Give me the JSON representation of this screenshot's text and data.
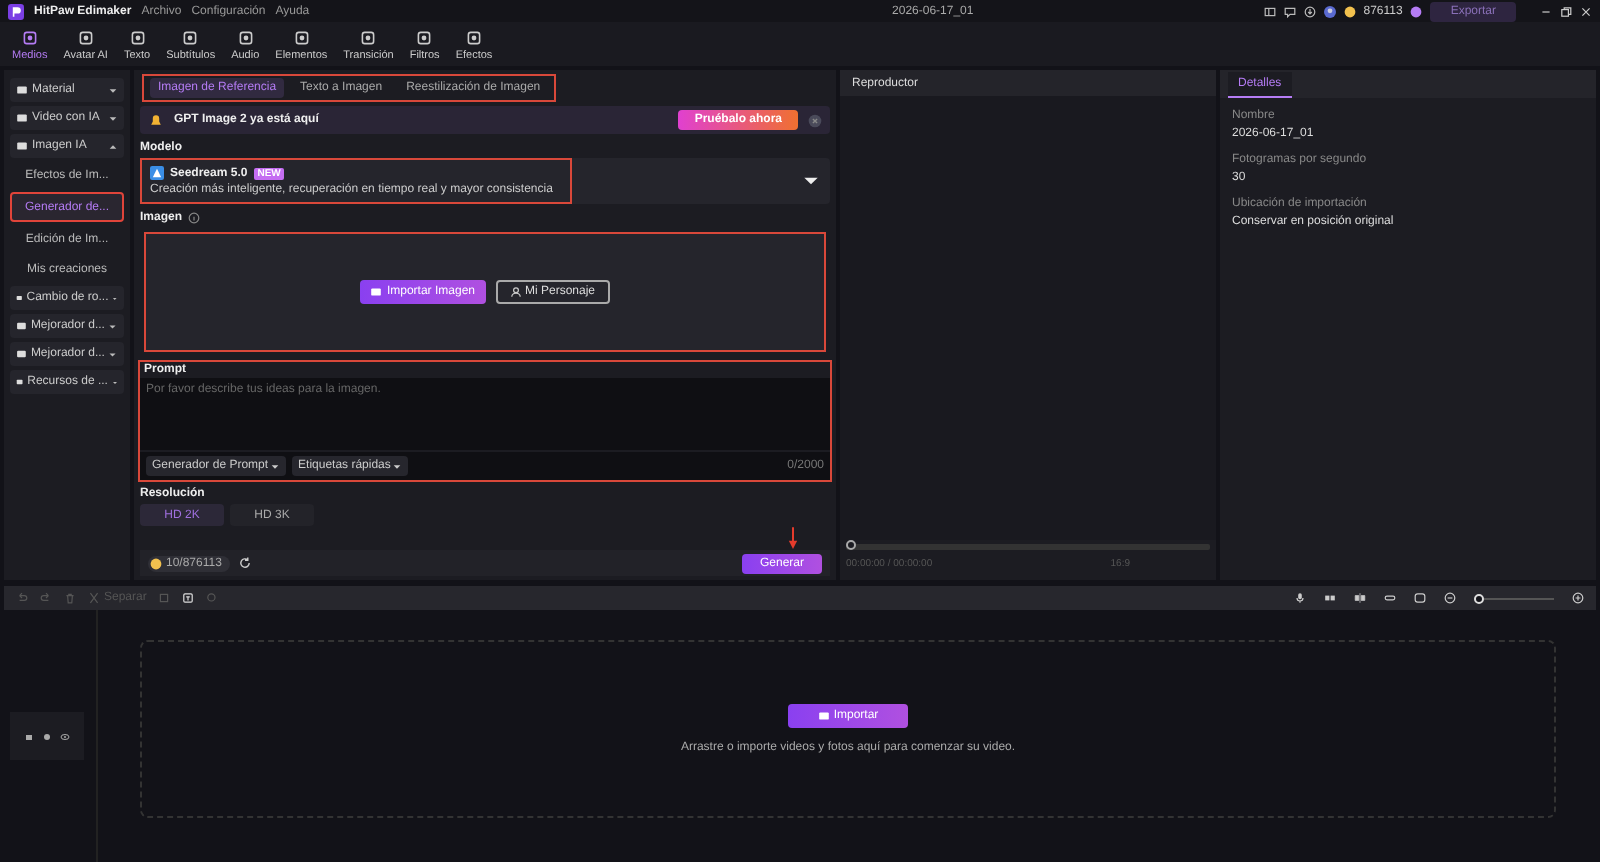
{
  "window": {
    "app_name": "HitPaw Edimaker",
    "menus": [
      "Archivo",
      "Configuración",
      "Ayuda"
    ],
    "project": "2026-06-17_01",
    "credits": "876113",
    "export_button": "Exportar"
  },
  "tabs": [
    {
      "label": "Medios",
      "selected": true
    },
    {
      "label": "Avatar AI",
      "selected": false
    },
    {
      "label": "Texto",
      "selected": false
    },
    {
      "label": "Subtítulos",
      "selected": false
    },
    {
      "label": "Audio",
      "selected": false
    },
    {
      "label": "Elementos",
      "selected": false
    },
    {
      "label": "Transición",
      "selected": false
    },
    {
      "label": "Filtros",
      "selected": false
    },
    {
      "label": "Efectos",
      "selected": false
    }
  ],
  "sidebar": {
    "items": [
      {
        "label": "Material",
        "expanded": false
      },
      {
        "label": "Video con IA",
        "expanded": false
      },
      {
        "label": "Imagen IA",
        "expanded": true,
        "children": [
          {
            "label": "Efectos de Im...",
            "selected": false
          },
          {
            "label": "Generador de...",
            "selected": true
          },
          {
            "label": "Edición de Im...",
            "selected": false
          },
          {
            "label": "Mis creaciones",
            "selected": false
          }
        ]
      },
      {
        "label": "Cambio de ro...",
        "expanded": false
      },
      {
        "label": "Mejorador d...",
        "expanded": false
      },
      {
        "label": "Mejorador d...",
        "expanded": false
      },
      {
        "label": "Recursos de ...",
        "expanded": false
      }
    ]
  },
  "generator": {
    "subtabs": [
      {
        "label": "Imagen de Referencia",
        "selected": true
      },
      {
        "label": "Texto a Imagen",
        "selected": false
      },
      {
        "label": "Reestilización de Imagen",
        "selected": false
      }
    ],
    "banner": {
      "text": "GPT Image 2 ya está aquí",
      "button": "Pruébalo ahora"
    },
    "model_label": "Modelo",
    "model": {
      "name": "Seedream 5.0",
      "badge": "NEW",
      "description": "Creación más inteligente, recuperación en tiempo real y mayor consistencia"
    },
    "image_label": "Imagen",
    "import_button": "Importar Imagen",
    "character_button": "Mi Personaje",
    "prompt_label": "Prompt",
    "prompt": {
      "placeholder": "Por favor describe tus ideas para la imagen."
    },
    "prompt_generator": "Generador de Prompt",
    "quick_tags": "Etiquetas rápidas",
    "char_count": "0/2000",
    "resolution_label": "Resolución",
    "resolutions": [
      {
        "label": "HD 2K",
        "selected": true
      },
      {
        "label": "HD 3K",
        "selected": false
      }
    ],
    "cost": "10/876113",
    "generate_button": "Generar"
  },
  "player": {
    "title": "Reproductor",
    "time": "00:00:00 / 00:00:00",
    "ratio": "16:9",
    "progress": {
      "level": 0
    }
  },
  "details": {
    "tab": "Detalles",
    "fields": [
      {
        "label": "Nombre",
        "value": "2026-06-17_01"
      },
      {
        "label": "Fotogramas por segundo",
        "value": "30"
      },
      {
        "label": "Ubicación de importación",
        "value": "Conservar en posición original"
      }
    ]
  },
  "timeline": {
    "split_button": "Separar",
    "import_button": "Importar",
    "hint": "Arrastre o importe videos y fotos aquí para comenzar su video.",
    "zoom": {
      "level": 0
    }
  }
}
